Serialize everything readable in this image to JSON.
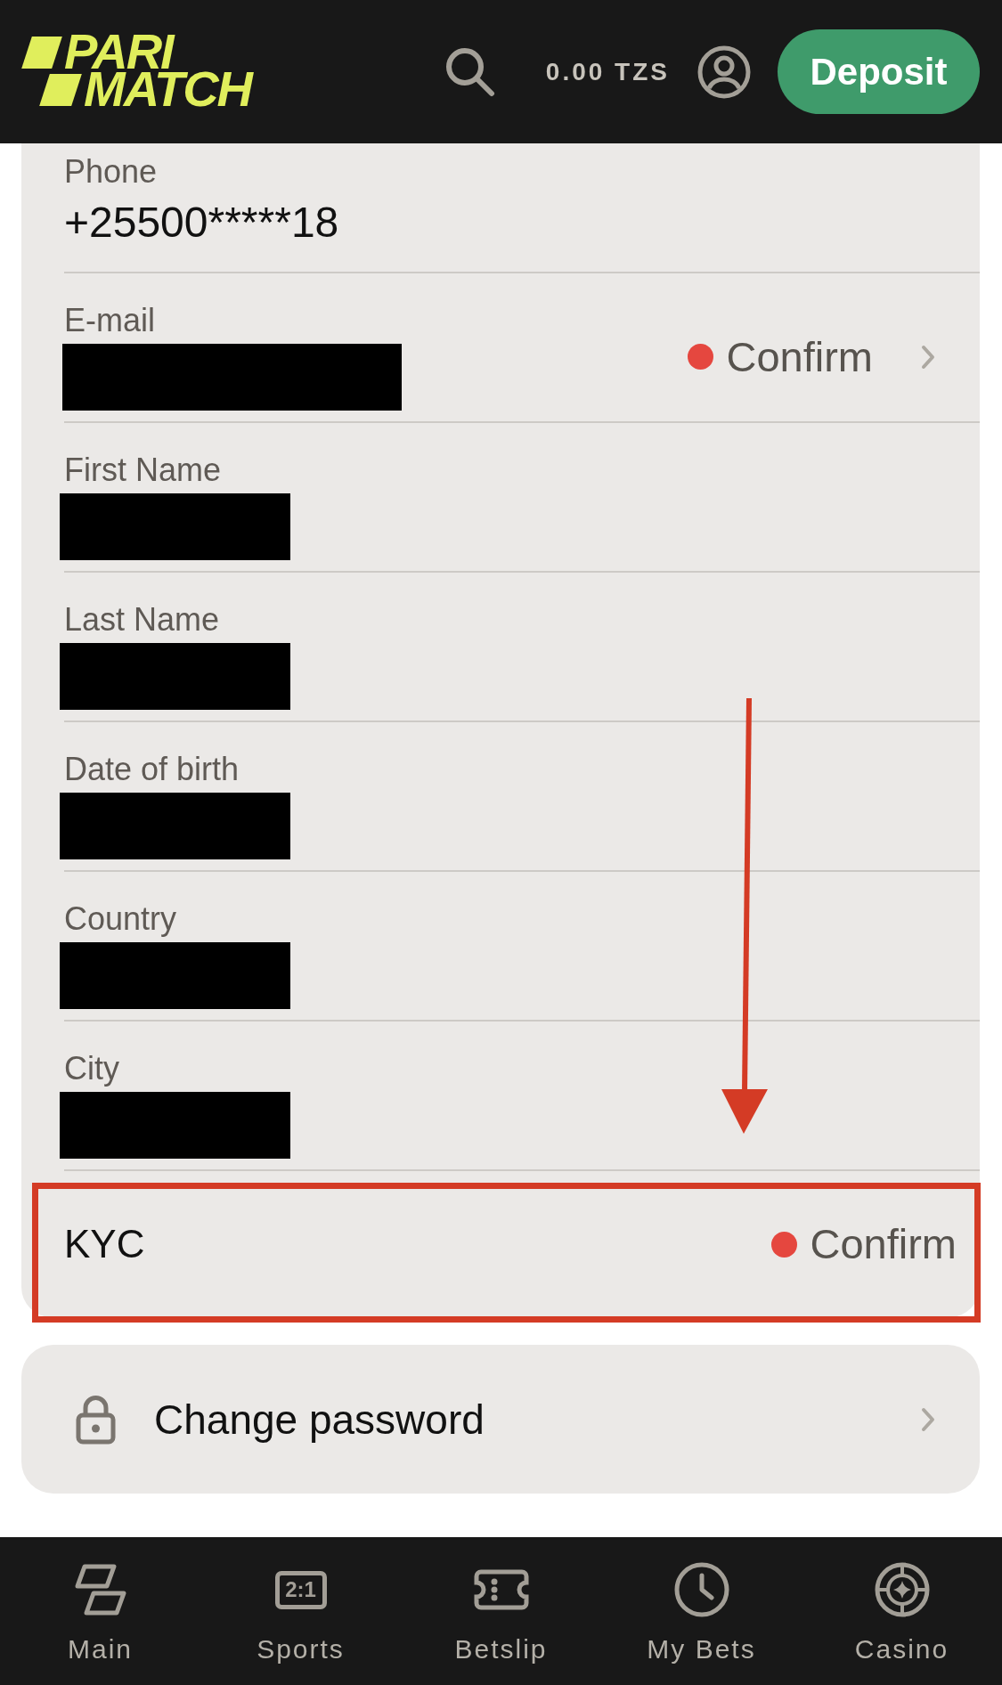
{
  "header": {
    "logo": [
      "PARI",
      "MATCH"
    ],
    "balance": "0.00 TZS",
    "deposit": "Deposit"
  },
  "profile_card": {
    "fields": [
      {
        "label": "Phone",
        "value": "+25500*****18",
        "redacted": false,
        "navigable": false
      },
      {
        "label": "E-mail",
        "redacted": true,
        "navigable": true,
        "status": {
          "text": "Confirm",
          "verified": false
        }
      },
      {
        "label": "First Name",
        "redacted": true,
        "navigable": false
      },
      {
        "label": "Last Name",
        "redacted": true,
        "navigable": false
      },
      {
        "label": "Date of birth",
        "redacted": true,
        "navigable": false
      },
      {
        "label": "Country",
        "redacted": true,
        "navigable": false
      },
      {
        "label": "City",
        "redacted": true,
        "navigable": false
      }
    ],
    "kyc": {
      "label": "KYC",
      "status": {
        "text": "Confirm",
        "verified": false
      },
      "highlighted": true
    }
  },
  "change_password": {
    "label": "Change password",
    "navigable": true
  },
  "bottom_nav": [
    {
      "label": "Main",
      "selected": false
    },
    {
      "label": "Sports",
      "icon_text": "2:1",
      "selected": false
    },
    {
      "label": "Betslip",
      "selected": false
    },
    {
      "label": "My Bets",
      "selected": false
    },
    {
      "label": "Casino",
      "selected": false
    }
  ]
}
